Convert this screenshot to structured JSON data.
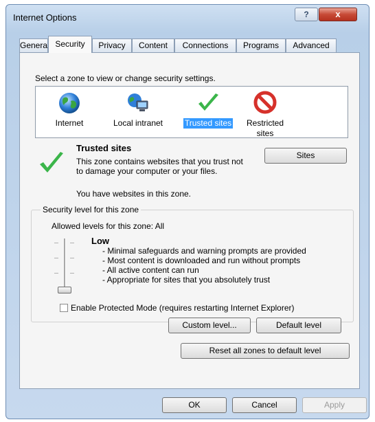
{
  "window": {
    "title": "Internet Options",
    "help_glyph": "?",
    "close_glyph": "x"
  },
  "tabs": [
    {
      "label": "General"
    },
    {
      "label": "Security"
    },
    {
      "label": "Privacy"
    },
    {
      "label": "Content"
    },
    {
      "label": "Connections"
    },
    {
      "label": "Programs"
    },
    {
      "label": "Advanced"
    }
  ],
  "security": {
    "zone_caption": "Select a zone to view or change security settings.",
    "zones": [
      {
        "label": "Internet",
        "icon": "globe-icon"
      },
      {
        "label": "Local intranet",
        "icon": "intranet-icon"
      },
      {
        "label": "Trusted sites",
        "icon": "checkmark-icon",
        "selected": true
      },
      {
        "label": "Restricted sites",
        "icon": "restricted-icon"
      }
    ],
    "zone_info": {
      "title": "Trusted sites",
      "description": "This zone contains websites that you trust not to damage your computer or your files.",
      "websites_note": "You have websites in this zone.",
      "sites_button": "Sites"
    },
    "level_group": {
      "legend": "Security level for this zone",
      "allowed": "Allowed levels for this zone: All",
      "slider_level": "Low",
      "level_title": "Low",
      "level_lines": [
        "- Minimal safeguards and warning prompts are provided",
        "- Most content is downloaded and run without prompts",
        "- All active content can run",
        "- Appropriate for sites that you absolutely trust"
      ],
      "protected_mode_label": "Enable Protected Mode (requires restarting Internet Explorer)",
      "protected_mode_checked": false,
      "custom_level_button": "Custom level...",
      "default_level_button": "Default level"
    },
    "reset_button": "Reset all zones to default level"
  },
  "footer": {
    "ok": "OK",
    "cancel": "Cancel",
    "apply": "Apply"
  },
  "colors": {
    "selection": "#3399ff",
    "checkmark": "#3bb54a",
    "restricted": "#d6312b"
  }
}
